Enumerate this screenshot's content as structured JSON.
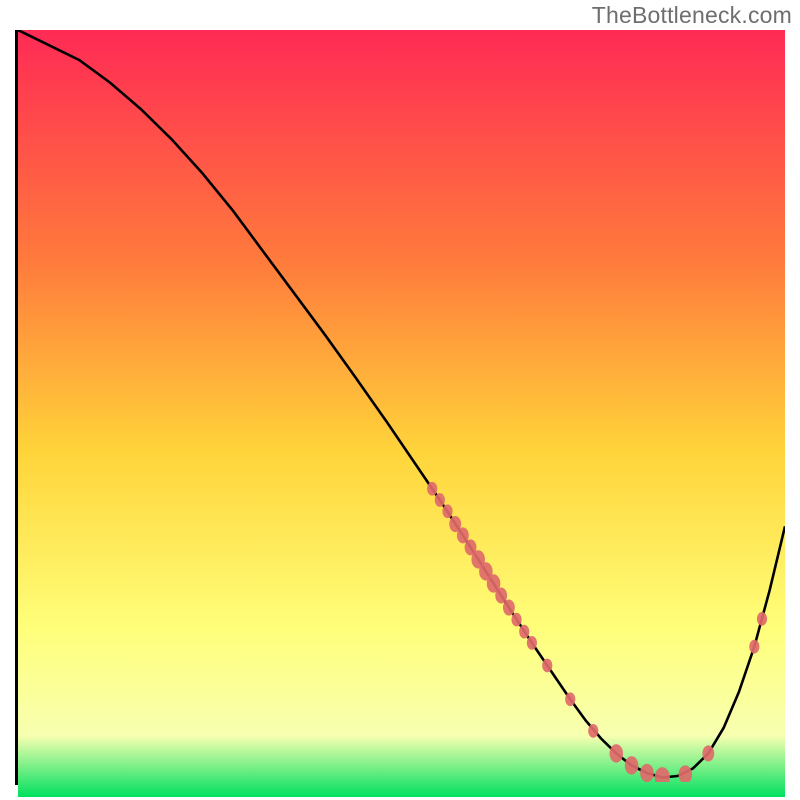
{
  "watermark": "TheBottleneck.com",
  "colors": {
    "gradient_top": "#ff2a55",
    "gradient_mid_upper": "#ff7a3c",
    "gradient_mid": "#ffd43a",
    "gradient_mid_lower": "#ffff7a",
    "gradient_lower": "#f7ffb0",
    "gradient_bottom": "#00e060",
    "curve_stroke": "#000000",
    "point_fill": "#e06a6a",
    "axis": "#000000"
  },
  "chart_data": {
    "type": "line",
    "title": "",
    "xlabel": "",
    "ylabel": "",
    "xlim": [
      0,
      100
    ],
    "ylim": [
      0,
      100
    ],
    "grid": false,
    "legend": false,
    "series": [
      {
        "name": "bottleneck-curve",
        "x": [
          0,
          4,
          8,
          12,
          16,
          20,
          24,
          28,
          32,
          36,
          40,
          44,
          48,
          52,
          55,
          58,
          61,
          64,
          67,
          70,
          72,
          74,
          76,
          78,
          80,
          82,
          84,
          86,
          88,
          90,
          92,
          94,
          96,
          98,
          100
        ],
        "y": [
          100,
          98,
          96,
          93,
          89.5,
          85.5,
          81,
          76,
          70.5,
          65,
          59.5,
          53.8,
          48,
          42,
          37.5,
          32.8,
          28,
          23.2,
          18.5,
          14,
          11,
          8.2,
          5.8,
          3.8,
          2.2,
          1.2,
          0.6,
          0.8,
          1.8,
          3.8,
          7.2,
          12,
          18,
          25.5,
          34
        ]
      }
    ],
    "scatter_points": {
      "name": "highlighted-points",
      "points": [
        {
          "x": 54,
          "y": 39,
          "r": 6
        },
        {
          "x": 55,
          "y": 37.5,
          "r": 6
        },
        {
          "x": 56,
          "y": 36,
          "r": 6
        },
        {
          "x": 57,
          "y": 34.3,
          "r": 7
        },
        {
          "x": 58,
          "y": 32.8,
          "r": 7
        },
        {
          "x": 59,
          "y": 31.2,
          "r": 7
        },
        {
          "x": 60,
          "y": 29.6,
          "r": 8
        },
        {
          "x": 61,
          "y": 28,
          "r": 8
        },
        {
          "x": 62,
          "y": 26.4,
          "r": 8
        },
        {
          "x": 63,
          "y": 24.8,
          "r": 7
        },
        {
          "x": 64,
          "y": 23.2,
          "r": 7
        },
        {
          "x": 65,
          "y": 21.6,
          "r": 6
        },
        {
          "x": 66,
          "y": 20,
          "r": 6
        },
        {
          "x": 67,
          "y": 18.5,
          "r": 6
        },
        {
          "x": 69,
          "y": 15.5,
          "r": 6
        },
        {
          "x": 72,
          "y": 11,
          "r": 6
        },
        {
          "x": 75,
          "y": 6.8,
          "r": 6
        },
        {
          "x": 78,
          "y": 3.8,
          "r": 8
        },
        {
          "x": 80,
          "y": 2.2,
          "r": 8
        },
        {
          "x": 82,
          "y": 1.2,
          "r": 8
        },
        {
          "x": 84,
          "y": 0.6,
          "r": 9
        },
        {
          "x": 87,
          "y": 1,
          "r": 8
        },
        {
          "x": 90,
          "y": 3.8,
          "r": 7
        },
        {
          "x": 96,
          "y": 18,
          "r": 6
        },
        {
          "x": 97,
          "y": 21.7,
          "r": 6
        }
      ]
    }
  }
}
